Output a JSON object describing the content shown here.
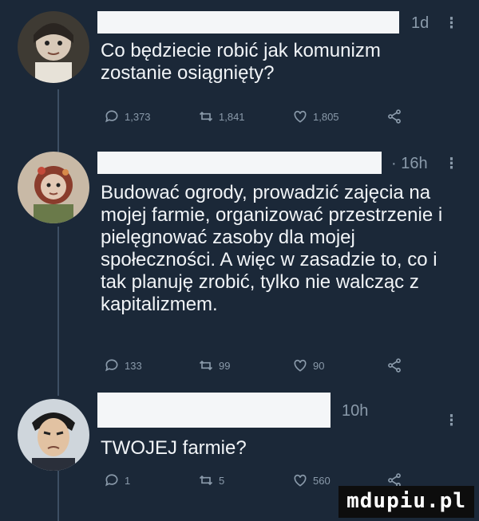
{
  "tweets": [
    {
      "time": "1d",
      "text": "Co będziecie robić jak komunizm zostanie osiągnięty?",
      "replies": "1,373",
      "retweets": "1,841",
      "likes": "1,805"
    },
    {
      "time": "· 16h",
      "text": "Budować ogrody, prowadzić zajęcia na mojej farmie, organizować przestrzenie i pielęgnować zasoby dla mojej społeczności. A więc w zasadzie to, co i tak planuję zrobić, tylko nie walcząc z kapitalizmem.",
      "replies": "133",
      "retweets": "99",
      "likes": "90"
    },
    {
      "time": "10h",
      "text": "TWOJEJ farmie?",
      "replies": "1",
      "retweets": "5",
      "likes": "560"
    }
  ],
  "watermark": "mdupiu.pl",
  "colors": {
    "background": "#1b2838",
    "muted": "#8a9aaa",
    "text": "#f1f4f7"
  }
}
